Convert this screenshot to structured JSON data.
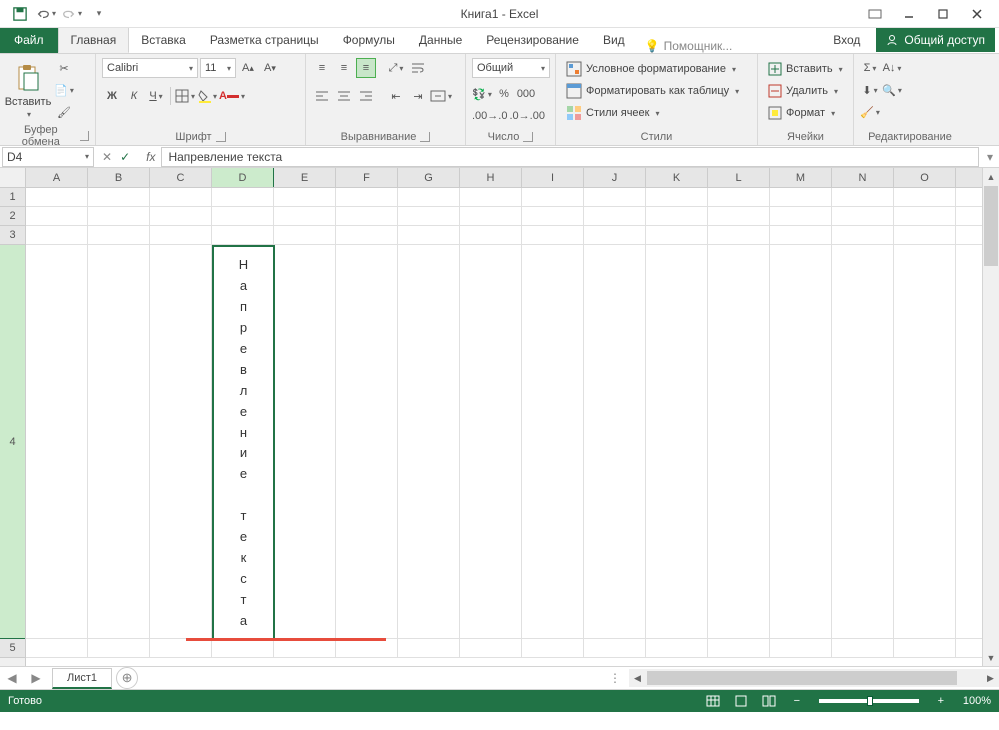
{
  "title": "Книга1 - Excel",
  "tabs": {
    "file": "Файл",
    "home": "Главная",
    "insert": "Вставка",
    "layout": "Разметка страницы",
    "formulas": "Формулы",
    "data": "Данные",
    "review": "Рецензирование",
    "view": "Вид"
  },
  "tellme": "Помощник...",
  "login": "Вход",
  "share": "Общий доступ",
  "ribbon": {
    "clipboard": {
      "paste": "Вставить",
      "label": "Буфер обмена"
    },
    "font": {
      "name": "Calibri",
      "size": "11",
      "b": "Ж",
      "i": "К",
      "u": "Ч",
      "label": "Шрифт"
    },
    "align": {
      "label": "Выравнивание"
    },
    "number": {
      "format": "Общий",
      "label": "Число"
    },
    "styles": {
      "cond": "Условное форматирование",
      "table": "Форматировать как таблицу",
      "cell": "Стили ячеек",
      "label": "Стили"
    },
    "cells": {
      "insert": "Вставить",
      "delete": "Удалить",
      "format": "Формат",
      "label": "Ячейки"
    },
    "editing": {
      "label": "Редактирование"
    }
  },
  "namebox": "D4",
  "formula": "Напревление текста",
  "columns": [
    "A",
    "B",
    "C",
    "D",
    "E",
    "F",
    "G",
    "H",
    "I",
    "J",
    "K",
    "L",
    "M",
    "N",
    "O"
  ],
  "rows": [
    "1",
    "2",
    "3",
    "4",
    "5"
  ],
  "cell_text": "Напревление текста",
  "sheet": "Лист1",
  "status": "Готово",
  "zoom": "100%"
}
